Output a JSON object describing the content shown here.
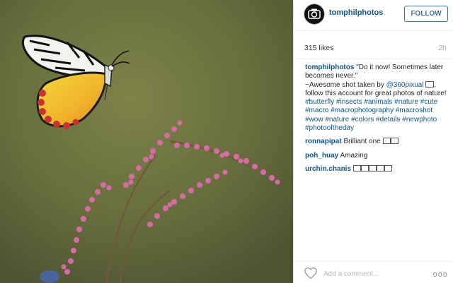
{
  "post": {
    "username": "tomphilphotos",
    "follow_label": "FOLLOW",
    "likes": "315 likes",
    "time": "2h",
    "caption_user": "tomphilphotos",
    "caption_line1": "\"Do it now! Sometimes later becomes never.\"",
    "caption_line2_pre": "~Awesome shot taken by ",
    "caption_mention": "@360pixual",
    "caption_line3": "follow this account for great photos of nature!",
    "hashtags": "#butterfly #insects #animals #nature #cute #macro #macrophotography #macroshot #wow #nature #colors #details #newphoto #photooftheday",
    "comments": [
      {
        "user": "ronnapipat",
        "text": "Brilliant one"
      },
      {
        "user": "poh_huay",
        "text": "Amazing"
      },
      {
        "user": "urchin.chanis",
        "text": ""
      }
    ],
    "add_comment_placeholder": "Add a comment...",
    "more_label": "ooo"
  },
  "icons": {
    "avatar": "camera-logo-icon",
    "heart": "heart-icon",
    "more": "ellipsis-icon"
  },
  "colors": {
    "link": "#125688",
    "follow": "#3f729b"
  }
}
